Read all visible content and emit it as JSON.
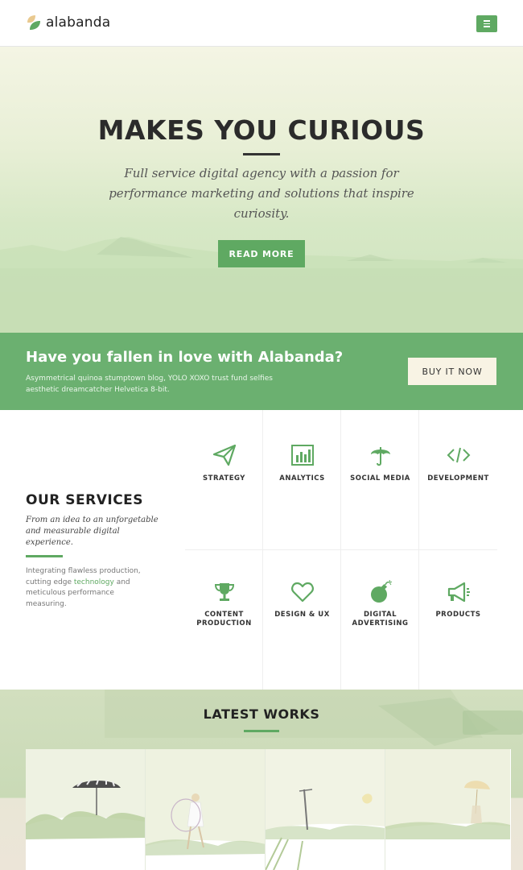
{
  "header": {
    "logo_text": "alabanda",
    "menu_icon": "hamburger-icon"
  },
  "hero": {
    "title": "MAKES YOU CURIOUS",
    "subtitle": "Full service digital agency with a passion for performance marketing and solutions that inspire curiosity.",
    "button_label": "READ MORE"
  },
  "promo": {
    "title": "Have you fallen in love with Alabanda?",
    "text": "Asymmetrical quinoa stumptown blog, YOLO XOXO trust fund selfies aesthetic dreamcatcher Helvetica 8-bit.",
    "button_label": "BUY IT NOW"
  },
  "services": {
    "heading": "OUR SERVICES",
    "tagline": "From an idea to an unforgetable and measurable digital experience.",
    "desc_before": "Integrating flawless production, cutting edge ",
    "desc_link": "technology",
    "desc_after": " and meticulous performance measuring.",
    "items": [
      {
        "label": "STRATEGY",
        "icon": "paper-plane-icon"
      },
      {
        "label": "ANALYTICS",
        "icon": "bar-chart-icon"
      },
      {
        "label": "SOCIAL MEDIA",
        "icon": "umbrella-icon"
      },
      {
        "label": "DEVELOPMENT",
        "icon": "code-icon"
      },
      {
        "label": "CONTENT PRODUCTION",
        "icon": "trophy-icon"
      },
      {
        "label": "DESIGN & UX",
        "icon": "heart-icon"
      },
      {
        "label": "DIGITAL ADVERTISING",
        "icon": "bomb-icon"
      },
      {
        "label": "PRODUCTS",
        "icon": "megaphone-icon"
      }
    ]
  },
  "works": {
    "title": "LATEST WORKS"
  },
  "colors": {
    "accent": "#5fa962",
    "promo_bg": "#6bb070",
    "button_light": "#f8f3e4"
  }
}
